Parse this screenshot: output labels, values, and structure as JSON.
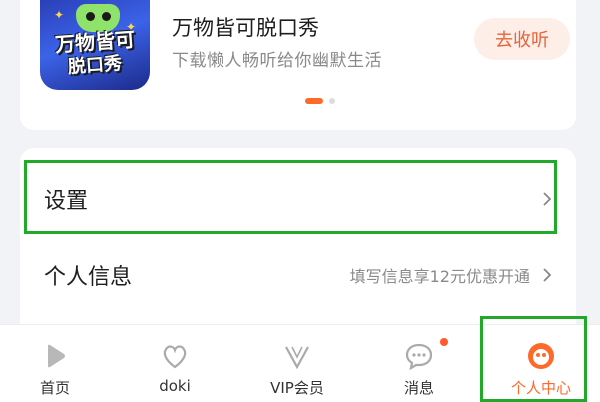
{
  "promo": {
    "art_line1": "万物皆可",
    "art_line2": "脱口秀",
    "title": "万物皆可脱口秀",
    "subtitle": "下载懒人畅听给你幽默生活",
    "button": "去收听",
    "carousel_page": 1,
    "carousel_total": 2
  },
  "settings": {
    "items": [
      {
        "label": "设置",
        "hint": ""
      },
      {
        "label": "个人信息",
        "hint": "填写信息享12元优惠开通"
      }
    ]
  },
  "nav": {
    "tabs": [
      {
        "label": "首页",
        "icon": "play-icon"
      },
      {
        "label": "doki",
        "icon": "heart-icon"
      },
      {
        "label": "VIP会员",
        "icon": "vip-icon"
      },
      {
        "label": "消息",
        "icon": "message-icon"
      },
      {
        "label": "个人中心",
        "icon": "profile-icon"
      }
    ],
    "active_index": 4,
    "accent": "#ff6a2b"
  },
  "colors": {
    "accent": "#ff6a2b",
    "highlight": "#22a92a"
  }
}
